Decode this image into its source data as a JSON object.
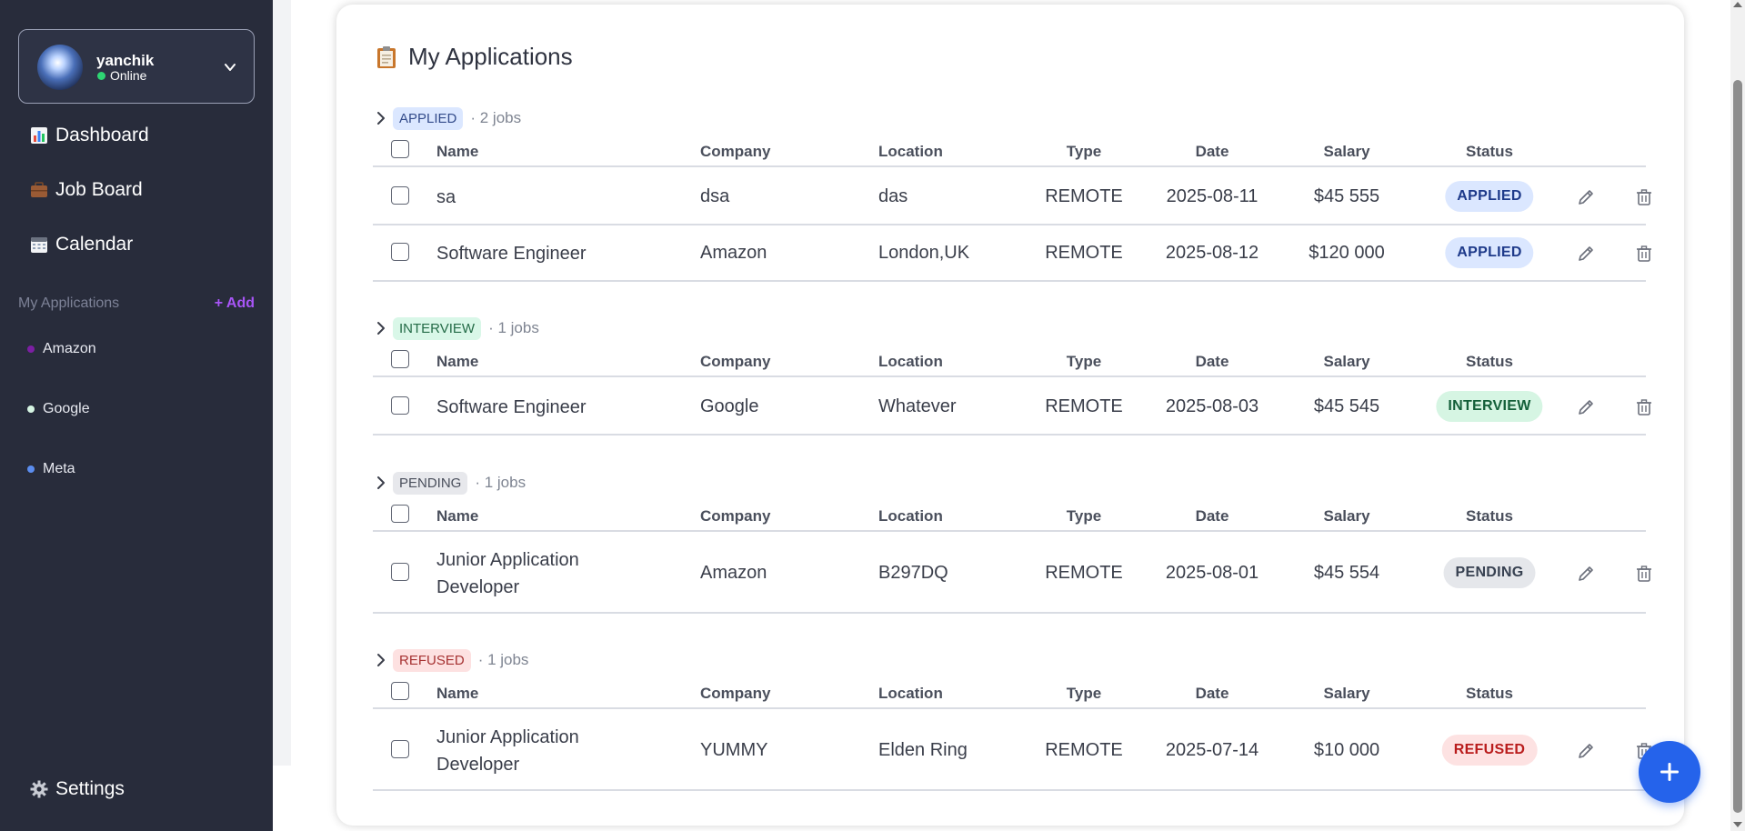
{
  "user": {
    "name": "yanchik",
    "status": "Online"
  },
  "nav": [
    {
      "label": "Dashboard",
      "icon": "bar-chart-icon"
    },
    {
      "label": "Job Board",
      "icon": "briefcase-icon"
    },
    {
      "label": "Calendar",
      "icon": "calendar-icon"
    }
  ],
  "sidebar_apps": {
    "label": "My Applications",
    "add_label": "+ Add",
    "items": [
      {
        "label": "Amazon",
        "color": "#7c1fa3"
      },
      {
        "label": "Google",
        "color": "#d6f5e3"
      },
      {
        "label": "Meta",
        "color": "#5b8def"
      }
    ]
  },
  "settings_label": "Settings",
  "page": {
    "title": "My Applications",
    "title_icon": "clipboard-icon"
  },
  "columns": {
    "name": "Name",
    "company": "Company",
    "location": "Location",
    "type": "Type",
    "date": "Date",
    "salary": "Salary",
    "status": "Status"
  },
  "groups": [
    {
      "label": "APPLIED",
      "count": "· 2 jobs",
      "pill_bg": "#dbe7ff",
      "pill_fg": "#334b8a",
      "rows": [
        {
          "name": "sa",
          "company": "dsa",
          "location": "das",
          "type": "REMOTE",
          "date": "2025-08-11",
          "salary": "$45 555",
          "status": "APPLIED"
        },
        {
          "name": "Software Engineer",
          "company": "Amazon",
          "location": "London,UK",
          "type": "REMOTE",
          "date": "2025-08-12",
          "salary": "$120 000",
          "status": "APPLIED"
        }
      ]
    },
    {
      "label": "INTERVIEW",
      "count": "· 1 jobs",
      "pill_bg": "#d9f7e8",
      "pill_fg": "#246b47",
      "rows": [
        {
          "name": "Software Engineer",
          "company": "Google",
          "location": "Whatever",
          "type": "REMOTE",
          "date": "2025-08-03",
          "salary": "$45 545",
          "status": "INTERVIEW"
        }
      ]
    },
    {
      "label": "PENDING",
      "count": "· 1 jobs",
      "pill_bg": "#e7e8ec",
      "pill_fg": "#4a4f5c",
      "rows": [
        {
          "name": "Junior Application Developer",
          "company": "Amazon",
          "location": "B297DQ",
          "type": "REMOTE",
          "date": "2025-08-01",
          "salary": "$45 554",
          "status": "PENDING"
        }
      ]
    },
    {
      "label": "REFUSED",
      "count": "· 1 jobs",
      "pill_bg": "#fde1e1",
      "pill_fg": "#a63232",
      "rows": [
        {
          "name": "Junior Application Developer",
          "company": "YUMMY",
          "location": "Elden Ring",
          "type": "REMOTE",
          "date": "2025-07-14",
          "salary": "$10 000",
          "status": "REFUSED"
        }
      ]
    }
  ],
  "status_colors": {
    "APPLIED": {
      "bg": "#dbe7ff",
      "fg": "#1e3a8a"
    },
    "INTERVIEW": {
      "bg": "#d6f5e3",
      "fg": "#14603a"
    },
    "PENDING": {
      "bg": "#e5e7eb",
      "fg": "#374151"
    },
    "REFUSED": {
      "bg": "#fde2e2",
      "fg": "#b91c1c"
    }
  },
  "fab_icon": "plus-icon",
  "accent": "#2563eb"
}
